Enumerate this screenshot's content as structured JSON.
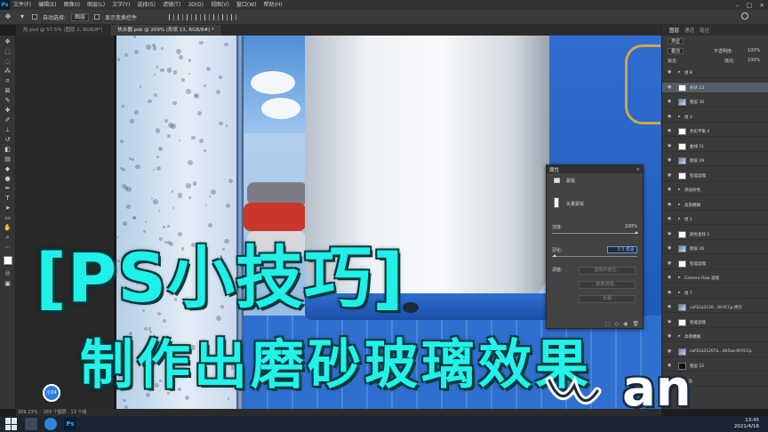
{
  "menubar": {
    "app_icon": "Ps",
    "items": [
      "文件(F)",
      "编辑(E)",
      "图像(I)",
      "图层(L)",
      "文字(Y)",
      "选择(S)",
      "滤镜(T)",
      "3D(D)",
      "视图(V)",
      "窗口(W)",
      "帮助(H)"
    ]
  },
  "optionsbar": {
    "auto_select_label": "自动选择:",
    "auto_select_value": "图层",
    "transform_label": "显示变换控件"
  },
  "tabs": [
    {
      "label": "热.psd @ 57.5% (图层 2, RGB/8*)",
      "active": false
    },
    {
      "label": "热水器.psb @ 209% (形状 13, RGB/8#) *",
      "active": true
    }
  ],
  "properties": {
    "title": "属性",
    "section": "蒙版",
    "mask_type": "矢量蒙版",
    "density_label": "浓度:",
    "density_value": "100%",
    "feather_label": "羽化:",
    "feather_value": "0.5 像素",
    "refine_label": "调整:",
    "select_subject": "选择并遮住...",
    "color_range": "颜色范围...",
    "invert": "反相"
  },
  "layers": {
    "tabs": [
      "图层",
      "通道",
      "路径"
    ],
    "filter_label": "类型",
    "blend_mode": "叠加",
    "opacity_label": "不透明度:",
    "opacity_value": "100%",
    "lock_label": "锁定:",
    "fill_label": "填充:",
    "fill_value": "100%",
    "rows": [
      {
        "name": "组 8",
        "thumb": "none"
      },
      {
        "name": "形状 13",
        "thumb": "mask",
        "selected": true
      },
      {
        "name": "图层 30",
        "thumb": "photo"
      },
      {
        "name": "组 3",
        "thumb": "none"
      },
      {
        "name": "色彩平衡 4",
        "thumb": "mask"
      },
      {
        "name": "曲线 51",
        "thumb": "mask"
      },
      {
        "name": "图层 29",
        "thumb": "photo"
      },
      {
        "name": "智能滤镜",
        "thumb": "mask"
      },
      {
        "name": "添加杂色",
        "thumb": "none"
      },
      {
        "name": "高斯模糊",
        "thumb": "none"
      },
      {
        "name": "组 1",
        "thumb": "none"
      },
      {
        "name": "颜色查找 1",
        "thumb": "mask"
      },
      {
        "name": "图层 26",
        "thumb": "photo"
      },
      {
        "name": "智能滤镜",
        "thumb": "mask"
      },
      {
        "name": "Camera Raw 滤镜",
        "thumb": "none"
      },
      {
        "name": "组 7",
        "thumb": "none"
      },
      {
        "name": "caf31a2120...XhYCCp 拷贝",
        "thumb": "photo"
      },
      {
        "name": "智能滤镜",
        "thumb": "mask"
      },
      {
        "name": "高斯模糊",
        "thumb": "none"
      },
      {
        "name": "caf31a21207a...4b5aa-XhYCCp",
        "thumb": "photo"
      },
      {
        "name": "图层 22",
        "thumb": "dark"
      },
      {
        "name": "产品",
        "thumb": "none"
      }
    ]
  },
  "statusbar": {
    "zoom": "209.23%",
    "info": "183 个图层 · 13 个组"
  },
  "taskbar": {
    "time": "13:45",
    "date": "2021/4/16"
  },
  "overlay": {
    "title_line1": "[PS小技巧]",
    "title_line2": "制作出磨砂玻璃效果",
    "corner_text": "an",
    "badge": "小24"
  }
}
